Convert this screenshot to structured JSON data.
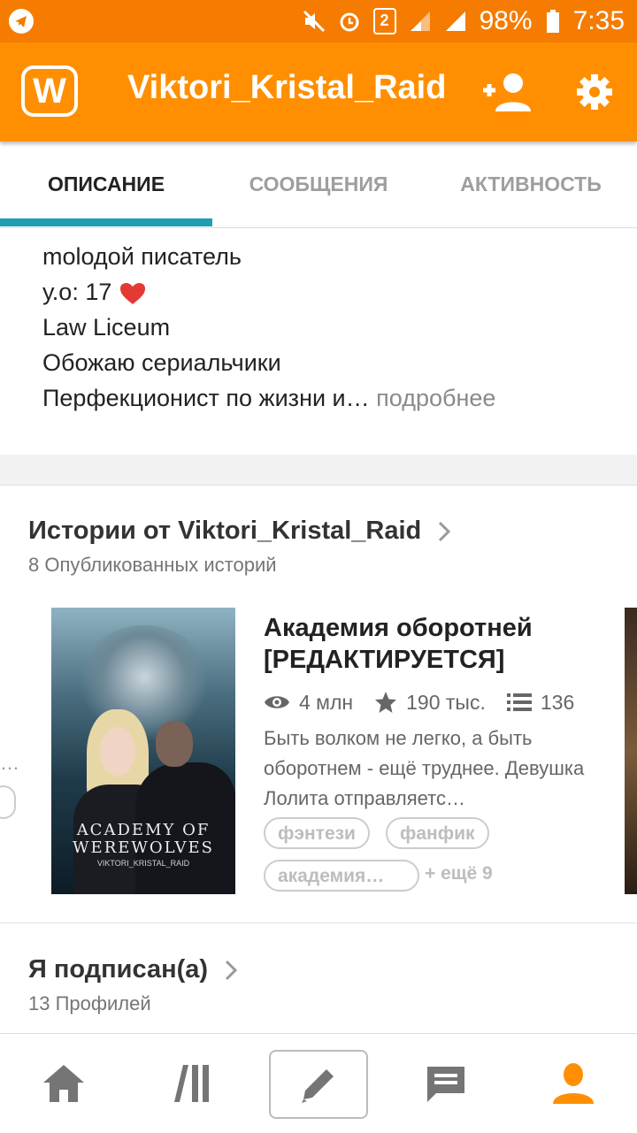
{
  "status_bar": {
    "battery": "98%",
    "time": "7:35",
    "sim_badge": "2"
  },
  "app_bar": {
    "logo_letter": "W",
    "title": "Viktori_Kristal_Raid"
  },
  "tabs": [
    {
      "label": "ОПИСАНИЕ",
      "active": true
    },
    {
      "label": "СООБЩЕНИЯ",
      "active": false
    },
    {
      "label": "АКТИВНОСТЬ",
      "active": false
    }
  ],
  "about": {
    "line1": "molодой писатель",
    "line2": "у.о: 17",
    "line3": "Law Liceum",
    "line4": "Обожаю сериальчики",
    "line5": "Перфекционист по жизни и…",
    "more": " подробнее"
  },
  "stories_section": {
    "title": "Истории от Viktori_Kristal_Raid",
    "subtitle": "8 Опубликованных историй"
  },
  "story": {
    "cover_title": "ACADEMY OF WEREWOLVES",
    "cover_author": "VIKTORI_KRISTAL_RAID",
    "title": "Академия оборотней [РЕДАКТИРУЕТСЯ]",
    "reads": "4 млн",
    "votes": "190 тыс.",
    "parts": "136",
    "description": "Быть волком не легко, а быть оборотнем - ещё труднее. Девушка Лолита отправляетс…",
    "tags": [
      "фэнтези",
      "фанфик",
      "академия…"
    ],
    "more_tags": "+ ещё 9"
  },
  "following_section": {
    "title": "Я подписан(а)",
    "subtitle": "13 Профилей"
  },
  "colors": {
    "status_bar": "#f57c00",
    "app_bar": "#ff8f00",
    "tab_indicator": "#1e9eb5",
    "nav_active": "#ff8f00",
    "nav_inactive": "#757575"
  }
}
